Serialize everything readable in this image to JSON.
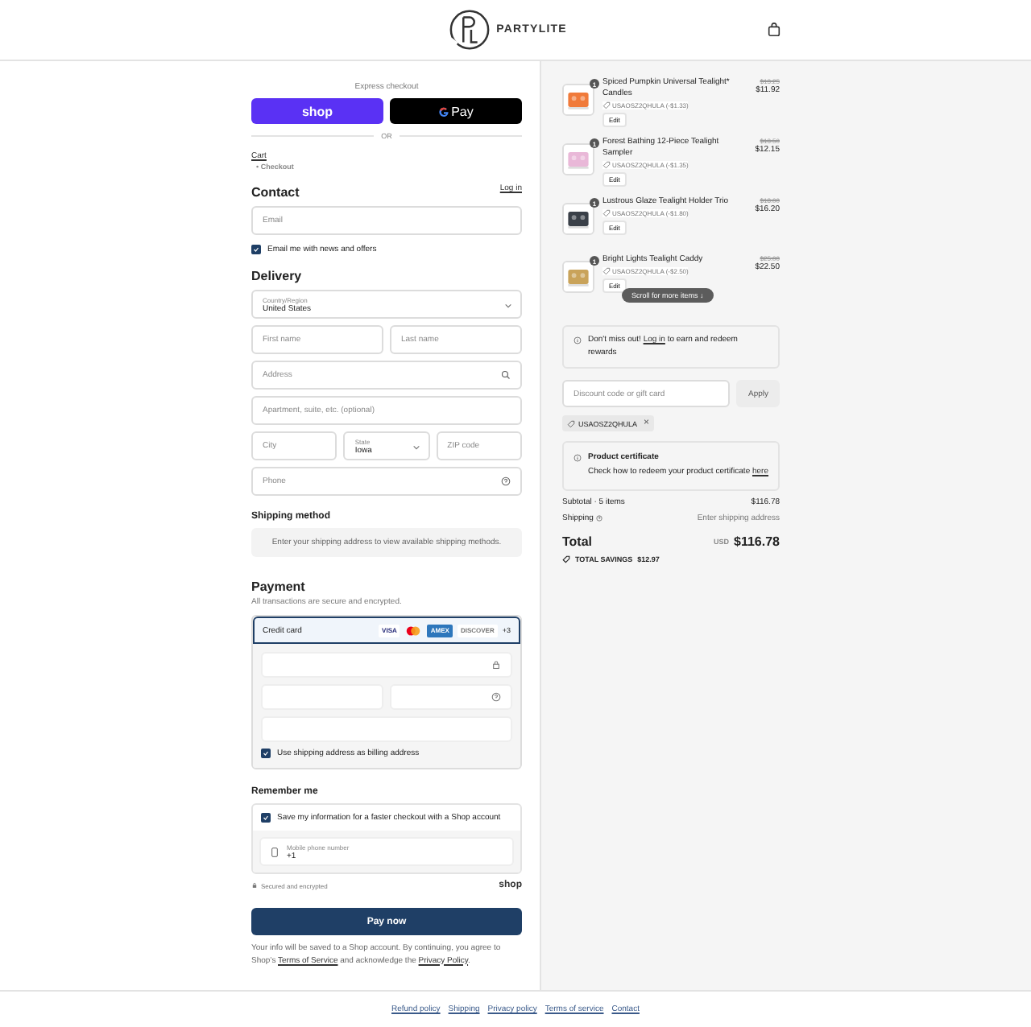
{
  "header": {
    "brand": "PARTYLITE"
  },
  "express": {
    "label": "Express checkout",
    "buttons": [
      {
        "kind": "shop",
        "label": "shop"
      },
      {
        "kind": "gpay",
        "label": "Pay"
      }
    ],
    "divider": "OR"
  },
  "breadcrumb": [
    {
      "label": "Cart",
      "current": false
    },
    {
      "marker": "•",
      "label": "Checkout",
      "current": true
    }
  ],
  "contact": {
    "heading": "Contact",
    "login": "Log in",
    "email_placeholder": "Email",
    "news": {
      "label": "Email me with news and offers",
      "checked": true
    }
  },
  "delivery": {
    "heading": "Delivery",
    "rows": [
      [
        {
          "kind": "select",
          "label": "Country/Region",
          "value": "United States"
        }
      ],
      [
        {
          "kind": "text",
          "placeholder": "First name"
        },
        {
          "kind": "text",
          "placeholder": "Last name"
        }
      ],
      [
        {
          "kind": "text",
          "placeholder": "Address"
        }
      ],
      [
        {
          "kind": "text",
          "placeholder": "Apartment, suite, etc. (optional)"
        }
      ],
      [
        {
          "kind": "text",
          "placeholder": "City"
        },
        {
          "kind": "select",
          "label": "State",
          "value": "Iowa"
        },
        {
          "kind": "text",
          "placeholder": "ZIP code"
        }
      ],
      [
        {
          "kind": "text",
          "placeholder": "Phone"
        }
      ]
    ]
  },
  "shipping_method": {
    "heading": "Shipping method",
    "message": "Enter your shipping address to view available shipping methods."
  },
  "payment": {
    "heading": "Payment",
    "note": "All transactions are secure and encrypted.",
    "method": {
      "label": "Credit card",
      "selected": true,
      "cards": [
        {
          "kind": "visa",
          "label": "VISA"
        },
        {
          "kind": "mastercard"
        },
        {
          "kind": "amex",
          "label": "AMEX"
        },
        {
          "kind": "discover",
          "label": "DISCOVER"
        }
      ],
      "more": "+3"
    },
    "billing": {
      "label": "Use shipping address as billing address",
      "checked": true
    }
  },
  "remember": {
    "heading": "Remember me",
    "save": {
      "label": "Save my information for a faster checkout with a Shop account",
      "checked": true
    },
    "phone": {
      "label": "Mobile phone number",
      "value": "+1"
    }
  },
  "secure": {
    "label": "Secured and encrypted",
    "brand": "shop"
  },
  "pay_button": "Pay now",
  "notice": [
    {
      "text": "Your info will be saved to a Shop account. By continuing, you agree to Shop’s "
    },
    {
      "link": "Terms of Service"
    },
    {
      "text": " and acknowledge the "
    },
    {
      "link": "Privacy Policy"
    },
    {
      "text": "."
    }
  ],
  "items": [
    {
      "name": "Spiced Pumpkin Universal Tealight* Candles",
      "qty": "1",
      "discount": "USAOSZ2QHULA (-$1.33)",
      "old_price": "$13.25",
      "price": "$11.92",
      "edit": "Edit",
      "color": "#f07a3a"
    },
    {
      "name": "Forest Bathing 12-Piece Tealight Sampler",
      "qty": "1",
      "discount": "USAOSZ2QHULA (-$1.35)",
      "old_price": "$13.50",
      "price": "$12.15",
      "edit": "Edit",
      "color": "#e9b8d8"
    },
    {
      "name": "Lustrous Glaze Tealight Holder Trio",
      "qty": "1",
      "discount": "USAOSZ2QHULA (-$1.80)",
      "old_price": "$18.00",
      "price": "$16.20",
      "edit": "Edit",
      "color": "#3a4048"
    },
    {
      "name": "Bright Lights Tealight Caddy",
      "qty": "1",
      "discount": "USAOSZ2QHULA (-$2.50)",
      "old_price": "$25.00",
      "price": "$22.50",
      "edit": "Edit",
      "color": "#c9a35a"
    }
  ],
  "scroll_hint": "Scroll for more items ↓",
  "rewards": [
    {
      "text": "Don't miss out! "
    },
    {
      "link": "Log in"
    },
    {
      "text": " to earn and redeem rewards"
    }
  ],
  "discount": {
    "placeholder": "Discount code or gift card",
    "button": "Apply",
    "applied": "USAOSZ2QHULA",
    "remove": "×"
  },
  "certificate": {
    "title": "Product certificate",
    "text": "Check how to redeem your product certificate ",
    "link": "here"
  },
  "summary": [
    {
      "label": "Subtotal · 5 items",
      "value": "$116.78",
      "info": false
    },
    {
      "label": "Shipping",
      "value": "Enter shipping address",
      "info": true
    }
  ],
  "total": {
    "label": "Total",
    "currency": "USD",
    "amount": "$116.78"
  },
  "savings": {
    "label": "TOTAL SAVINGS",
    "amount": "$12.97"
  },
  "footer": [
    "Refund policy",
    "Shipping",
    "Privacy policy",
    "Terms of service",
    "Contact"
  ]
}
